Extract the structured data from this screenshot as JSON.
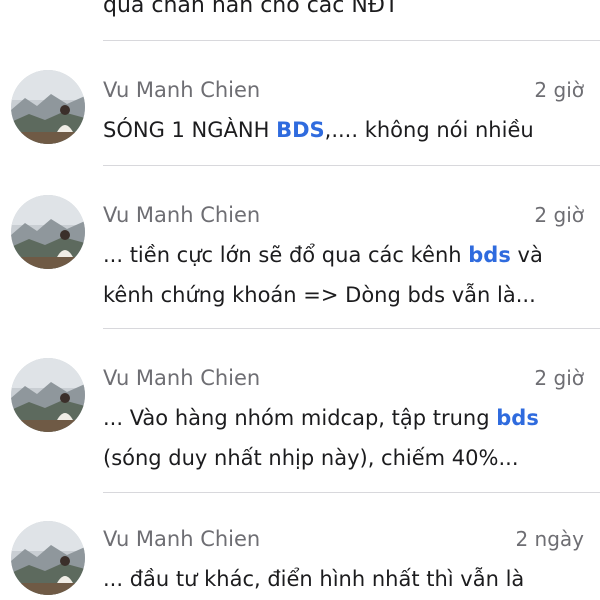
{
  "top_snippet": "quá chán nản cho các NĐT",
  "colors": {
    "text": "#1c1c1e",
    "meta": "#6e6e73",
    "highlight": "#2f6bde",
    "divider": "#d8d8dc"
  },
  "items": [
    {
      "author": "Vu Manh Chien",
      "time": "2 giờ",
      "avatar_icon": "user-avatar-mountain-photo",
      "line1": {
        "before": "SÓNG 1 NGÀNH ",
        "hl": "BDS",
        "after": ",.... không nói nhiều"
      }
    },
    {
      "author": "Vu Manh Chien",
      "time": "2 giờ",
      "avatar_icon": "user-avatar-mountain-photo",
      "line1": {
        "before": "... tiền cực lớn sẽ đổ qua các kênh ",
        "hl": "bds",
        "after": " và"
      },
      "line2": "kênh chứng khoán => Dòng bds vẫn là..."
    },
    {
      "author": "Vu Manh Chien",
      "time": "2 giờ",
      "avatar_icon": "user-avatar-mountain-photo",
      "line1": {
        "before": "... Vào hàng nhóm midcap, tập trung ",
        "hl": "bds",
        "after": ""
      },
      "line2": "(sóng duy nhất nhịp này), chiếm 40%..."
    },
    {
      "author": "Vu Manh Chien",
      "time": "2 ngày",
      "avatar_icon": "user-avatar-mountain-photo",
      "line1": {
        "before": "... đầu tư khác, điển hình nhất thì vẫn là",
        "hl": "",
        "after": ""
      }
    }
  ]
}
